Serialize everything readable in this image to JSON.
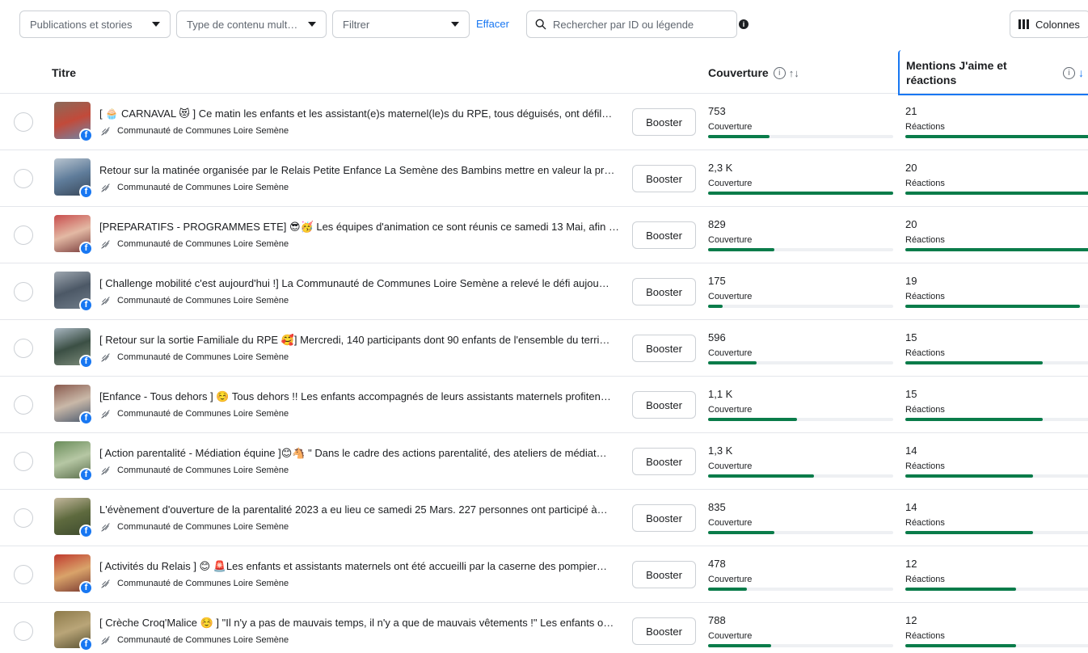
{
  "toolbar": {
    "filter_type": "Publications et stories",
    "content_type": "Type de contenu mult…",
    "filter": "Filtrer",
    "clear": "Effacer",
    "search_placeholder": "Rechercher par ID ou légende",
    "info": "i",
    "columns": "Colonnes"
  },
  "header": {
    "title": "Titre",
    "coverage": "Couverture",
    "coverage_sort": "↑↓",
    "reactions": "Mentions J'aime et réactions",
    "reactions_sort": "↓",
    "info": "i"
  },
  "rows": [
    {
      "text": "[ 🧁 CARNAVAL 😻 ] Ce matin les enfants et les assistant(e)s maternel(le)s du RPE, tous déguisés, ont défil…",
      "author": "Communauté de Communes Loire Semène",
      "boost": "Booster",
      "coverage": "753",
      "coverage_label": "Couverture",
      "coverage_ratio": 0.33,
      "reactions": "21",
      "reactions_label": "Réactions",
      "reactions_ratio": 1.0,
      "thumb": [
        "#8a6a5a",
        "#c24a3a",
        "#6f86a8"
      ]
    },
    {
      "text": "Retour sur la matinée organisée par le Relais Petite Enfance La Semène des Bambins mettre en valeur la pr…",
      "author": "Communauté de Communes Loire Semène",
      "boost": "Booster",
      "coverage": "2,3 K",
      "coverage_label": "Couverture",
      "coverage_ratio": 1.0,
      "reactions": "20",
      "reactions_label": "Réactions",
      "reactions_ratio": 0.95,
      "thumb": [
        "#b8c4cf",
        "#5f7c9a",
        "#39485a"
      ]
    },
    {
      "text": "[PREPARATIFS - PROGRAMMES ETE] 😎🥳 Les équipes d'animation ce sont réunis ce samedi 13 Mai, afin d…",
      "author": "Communauté de Communes Loire Semène",
      "boost": "Booster",
      "coverage": "829",
      "coverage_label": "Couverture",
      "coverage_ratio": 0.36,
      "reactions": "20",
      "reactions_label": "Réactions",
      "reactions_ratio": 0.95,
      "thumb": [
        "#c84d4d",
        "#e3b9a4",
        "#7a3c3c"
      ]
    },
    {
      "text": "[ Challenge mobilité c'est aujourd'hui !] La Communauté de Communes Loire Semène a relevé le défi aujou…",
      "author": "Communauté de Communes Loire Semène",
      "boost": "Booster",
      "coverage": "175",
      "coverage_label": "Couverture",
      "coverage_ratio": 0.08,
      "reactions": "19",
      "reactions_label": "Réactions",
      "reactions_ratio": 0.9,
      "thumb": [
        "#9ea7b0",
        "#4c5866",
        "#6f7c89"
      ]
    },
    {
      "text": "[ Retour sur la sortie Familiale du RPE 🥰] Mercredi, 140 participants dont 90 enfants de l'ensemble du terri…",
      "author": "Communauté de Communes Loire Semène",
      "boost": "Booster",
      "coverage": "596",
      "coverage_label": "Couverture",
      "coverage_ratio": 0.26,
      "reactions": "15",
      "reactions_label": "Réactions",
      "reactions_ratio": 0.71,
      "thumb": [
        "#a9b7c2",
        "#3b4f44",
        "#7d8c7b"
      ]
    },
    {
      "text": "[Enfance - Tous dehors ] ☺️ Tous dehors !! Les enfants accompagnés de leurs assistants maternels profiten…",
      "author": "Communauté de Communes Loire Semène",
      "boost": "Booster",
      "coverage": "1,1 K",
      "coverage_label": "Couverture",
      "coverage_ratio": 0.48,
      "reactions": "15",
      "reactions_label": "Réactions",
      "reactions_ratio": 0.71,
      "thumb": [
        "#8a5a4e",
        "#c9b8a8",
        "#4b5a6e"
      ]
    },
    {
      "text": "[ Action parentalité - Médiation équine ]😊🐴 \" Dans le cadre des actions parentalité, des ateliers de médiat…",
      "author": "Communauté de Communes Loire Semène",
      "boost": "Booster",
      "coverage": "1,3 K",
      "coverage_label": "Couverture",
      "coverage_ratio": 0.57,
      "reactions": "14",
      "reactions_label": "Réactions",
      "reactions_ratio": 0.66,
      "thumb": [
        "#6a8d5a",
        "#b6c7a4",
        "#5a6e4b"
      ]
    },
    {
      "text": "L'évènement d'ouverture de la parentalité 2023 a eu lieu ce samedi 25 Mars. 227 personnes ont participé à…",
      "author": "Communauté de Communes Loire Semène",
      "boost": "Booster",
      "coverage": "835",
      "coverage_label": "Couverture",
      "coverage_ratio": 0.36,
      "reactions": "14",
      "reactions_label": "Réactions",
      "reactions_ratio": 0.66,
      "thumb": [
        "#c3b79c",
        "#5e6a3e",
        "#3d4a2e"
      ]
    },
    {
      "text": "[ Activités du Relais ] 😊 🚨Les enfants et assistants maternels ont été accueilli par la caserne des pompier…",
      "author": "Communauté de Communes Loire Semène",
      "boost": "Booster",
      "coverage": "478",
      "coverage_label": "Couverture",
      "coverage_ratio": 0.21,
      "reactions": "12",
      "reactions_label": "Réactions",
      "reactions_ratio": 0.57,
      "thumb": [
        "#c03a2e",
        "#d9a36a",
        "#7b3a30"
      ]
    },
    {
      "text": "[ Crèche Croq'Malice ☺️ ] \"Il n'y a pas de mauvais temps, il n'y a que de mauvais vêtements !\" Les enfants o…",
      "author": "Communauté de Communes Loire Semène",
      "boost": "Booster",
      "coverage": "788",
      "coverage_label": "Couverture",
      "coverage_ratio": 0.34,
      "reactions": "12",
      "reactions_label": "Réactions",
      "reactions_ratio": 0.57,
      "thumb": [
        "#8d7a4a",
        "#b9a578",
        "#5a5232"
      ]
    }
  ]
}
